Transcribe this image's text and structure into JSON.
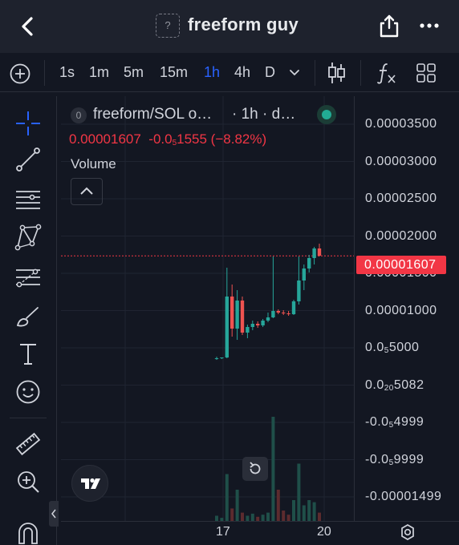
{
  "header": {
    "token_icon_text": "?",
    "title": "freeform guy"
  },
  "toolbar": {
    "intervals": [
      "1s",
      "1m",
      "5m",
      "15m",
      "1h",
      "4h",
      "D"
    ],
    "active_interval": "1h"
  },
  "legend": {
    "symbol": "freeform/SOL o…",
    "interval": "· 1h · d…",
    "badge": "0",
    "price": "0.00001607",
    "change_a": "-0.0",
    "change_sub": "5",
    "change_b": "1555 (−8.82%)",
    "volume_label": "Volume"
  },
  "price_axis": {
    "ticks": [
      {
        "a": "0.00003500",
        "sub": "",
        "b": ""
      },
      {
        "a": "0.00003000",
        "sub": "",
        "b": ""
      },
      {
        "a": "0.00002500",
        "sub": "",
        "b": ""
      },
      {
        "a": "0.00002000",
        "sub": "",
        "b": ""
      },
      {
        "a": "0.00001500",
        "sub": "",
        "b": ""
      },
      {
        "a": "0.00001000",
        "sub": "",
        "b": ""
      },
      {
        "a": "0.0",
        "sub": "5",
        "b": "5000"
      },
      {
        "a": "0.0",
        "sub": "20",
        "b": "5082"
      },
      {
        "a": "-0.0",
        "sub": "5",
        "b": "4999"
      },
      {
        "a": "-0.0",
        "sub": "5",
        "b": "9999"
      },
      {
        "a": "-0.00001499",
        "sub": "",
        "b": ""
      }
    ],
    "last_price_label": "0.00001607"
  },
  "time_axis": {
    "ticks": [
      "17",
      "20"
    ]
  },
  "colors": {
    "up": "#26a69a",
    "down": "#ef5350",
    "accent": "#2962ff",
    "background": "#131722"
  },
  "chart_data": {
    "type": "candlestick",
    "title": "freeform/SOL",
    "interval": "1h",
    "last_price": 1.607e-05,
    "change": -1.555e-06,
    "change_pct": -8.82,
    "y_axis_range": [
      -1.7e-05,
      3.6e-05
    ],
    "x_ticks": [
      "17",
      "20"
    ],
    "candles_ohlc": [
      [
        3.2e-06,
        3.5e-06,
        3.1e-06,
        3.3e-06
      ],
      [
        3.3e-06,
        3.4e-06,
        3.2e-06,
        3.4e-06
      ],
      [
        3.4e-06,
        1.46e-05,
        3.3e-06,
        1.1e-05
      ],
      [
        1.1e-05,
        1.25e-05,
        6e-06,
        7e-06
      ],
      [
        7e-06,
        1.18e-05,
        5.6e-06,
        1.05e-05
      ],
      [
        1.05e-05,
        1.1e-05,
        6.2e-06,
        6.5e-06
      ],
      [
        6.5e-06,
        7.5e-06,
        5.8e-06,
        7.2e-06
      ],
      [
        7.2e-06,
        8e-06,
        6.8e-06,
        7.6e-06
      ],
      [
        7.6e-06,
        7.9e-06,
        7.1e-06,
        7.4e-06
      ],
      [
        7.4e-06,
        8.2e-06,
        7.2e-06,
        8e-06
      ],
      [
        8e-06,
        9e-06,
        7.8e-06,
        8.4e-06
      ],
      [
        8.4e-06,
        1.6e-05,
        8.3e-06,
        9.2e-06
      ],
      [
        9.2e-06,
        9.4e-06,
        8.8e-06,
        9e-06
      ],
      [
        9e-06,
        9.3e-06,
        8.7e-06,
        8.9e-06
      ],
      [
        8.9e-06,
        9.2e-06,
        8.6e-06,
        8.8e-06
      ],
      [
        8.8e-06,
        1.06e-05,
        8.7e-06,
        1.04e-05
      ],
      [
        1.04e-05,
        1.6e-05,
        1e-05,
        1.3e-05
      ],
      [
        1.3e-05,
        1.5e-05,
        1.18e-05,
        1.45e-05
      ],
      [
        1.45e-05,
        1.62e-05,
        1.4e-05,
        1.58e-05
      ],
      [
        1.58e-05,
        1.72e-05,
        1.5e-05,
        1.7e-05
      ],
      [
        1.7e-05,
        1.76e-05,
        1.6e-05,
        1.61e-05
      ]
    ],
    "volume_rel": [
      0.05,
      0.03,
      0.45,
      0.12,
      0.3,
      0.08,
      0.05,
      0.07,
      0.04,
      0.06,
      0.08,
      1.0,
      0.3,
      0.1,
      0.06,
      0.2,
      0.55,
      0.15,
      0.2,
      0.18,
      0.08
    ]
  }
}
